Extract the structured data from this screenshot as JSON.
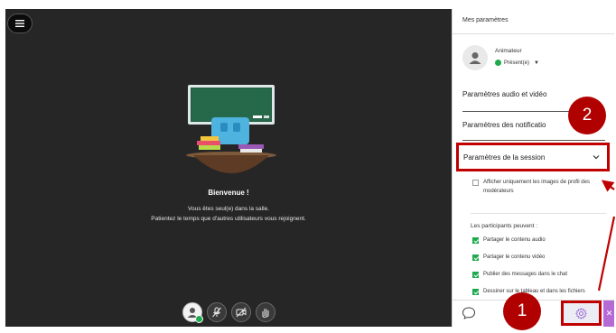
{
  "panel": {
    "title": "Mes paramètres",
    "role": "Animateur",
    "status": "Présent(e)",
    "sections": {
      "audio_video": "Paramètres audio et vidéo",
      "notifications": "Paramètres des notificatio",
      "session": "Paramètres de la session"
    },
    "moderator_option": "Afficher uniquement les images de profil des modérateurs",
    "participants_heading": "Les participants peuvent :",
    "participant_options": [
      "Partager le contenu audio",
      "Partager le contenu vidéo",
      "Publier des messages dans le chat",
      "Dessiner sur le tableau et dans les fichiers"
    ]
  },
  "stage": {
    "welcome_title": "Bienvenue !",
    "welcome_line1": "Vous êtes seul(e) dans la salle.",
    "welcome_line2": "Patientez le temps que d'autres utilisateurs vous rejoignent."
  },
  "annotations": {
    "badge1": "1",
    "badge2": "2"
  },
  "colors": {
    "stage_bg": "#262626",
    "highlight": "#c00000",
    "badge": "#b10000",
    "presence": "#1faa50",
    "close_button": "#b56ad6"
  },
  "icons": [
    "menu-icon",
    "user-icon",
    "mic-off-icon",
    "camera-off-icon",
    "hand-raise-icon",
    "chat-icon",
    "gear-icon",
    "close-icon",
    "chevron-down-icon"
  ]
}
